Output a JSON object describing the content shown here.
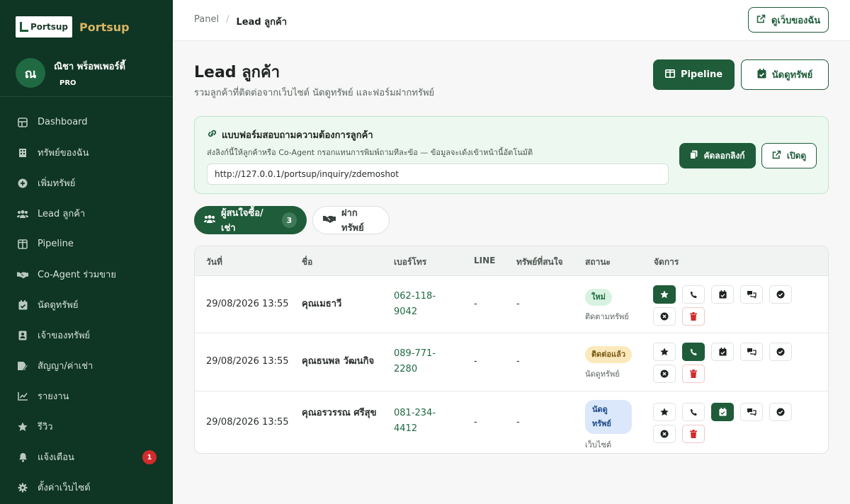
{
  "brand": {
    "logo_text": "Portsup",
    "name": "Portsup"
  },
  "user": {
    "initial": "ณ",
    "name": "ณิชา พร็อพเพอร์ตี้",
    "plan": "PRO"
  },
  "sidebar": {
    "items": [
      {
        "label": "Dashboard",
        "icon": "dashboard-icon"
      },
      {
        "label": "ทรัพย์ของฉัน",
        "icon": "building-icon"
      },
      {
        "label": "เพิ่มทรัพย์",
        "icon": "plus-circle-icon"
      },
      {
        "label": "Lead ลูกค้า",
        "icon": "users-icon"
      },
      {
        "label": "Pipeline",
        "icon": "columns-icon"
      },
      {
        "label": "Co-Agent ร่วมขาย",
        "icon": "handshake-icon"
      },
      {
        "label": "นัดดูทรัพย์",
        "icon": "calendar-check-icon"
      },
      {
        "label": "เจ้าของทรัพย์",
        "icon": "id-card-icon"
      },
      {
        "label": "สัญญา/ค่าเช่า",
        "icon": "contract-icon"
      },
      {
        "label": "รายงาน",
        "icon": "chart-line-icon"
      },
      {
        "label": "รีวิว",
        "icon": "star-icon"
      },
      {
        "label": "แจ้งเตือน",
        "icon": "bell-icon",
        "badge": "1"
      },
      {
        "label": "ตั้งค่าเว็บไซต์",
        "icon": "gear-icon"
      }
    ]
  },
  "topbar": {
    "breadcrumb": [
      "Panel",
      "Lead ลูกค้า"
    ],
    "view_site_label": "ดูเว็บของฉัน"
  },
  "header": {
    "title": "Lead ลูกค้า",
    "subtitle": "รวมลูกค้าที่ติดต่อจากเว็บไซต์ นัดดูทรัพย์ และฟอร์มฝากทรัพย์",
    "pipeline_label": "Pipeline",
    "appointment_label": "นัดดูทรัพย์"
  },
  "inquiry_form": {
    "title": "แบบฟอร์มสอบถามความต้องการลูกค้า",
    "description": "ส่งลิงก์นี้ให้ลูกค้าหรือ Co-Agent กรอกแทนการพิมพ์ถามทีละข้อ — ข้อมูลจะเด้งเข้าหน้านี้อัตโนมัติ",
    "url": "http://127.0.0.1/portsup/inquiry/zdemoshot",
    "copy_label": "คัดลอกลิงก์",
    "open_label": "เปิดดู"
  },
  "tabs": {
    "buyers": {
      "label": "ผู้สนใจซื้อ/เช่า",
      "count": "3"
    },
    "listings": {
      "label": "ฝากทรัพย์"
    }
  },
  "table": {
    "columns": [
      "วันที่",
      "ชื่อ",
      "เบอร์โทร",
      "LINE",
      "ทรัพย์ที่สนใจ",
      "สถานะ",
      "จัดการ"
    ],
    "rows": [
      {
        "date": "29/08/2026 13:55",
        "name": "คุณเมธาวี",
        "phone": "062-118-9042",
        "line": "-",
        "property": "-",
        "status": "ใหม่",
        "status_color": "#d7f2e1",
        "source": "ติดตามทรัพย์",
        "active_action": "star"
      },
      {
        "date": "29/08/2026 13:55",
        "name": "คุณธนพล วัฒนกิจ",
        "phone": "089-771-2280",
        "line": "-",
        "property": "-",
        "status": "ติดต่อแล้ว",
        "status_color": "#fbe9bd",
        "source": "นัดดูทรัพย์",
        "active_action": "phone"
      },
      {
        "date": "29/08/2026 13:55",
        "name": "คุณอรวรรณ ศรีสุข",
        "phone": "081-234-4412",
        "line": "-",
        "property": "-",
        "status": "นัดดูทรัพย์",
        "status_color": "#dbe8fb",
        "source": "เว็บไซต์",
        "active_action": "calendar"
      }
    ]
  },
  "colors": {
    "sidebar_bg": "#0f3524",
    "accent": "#1f5c3a",
    "brand_gold": "#d9b463",
    "danger": "#d22b2b"
  }
}
